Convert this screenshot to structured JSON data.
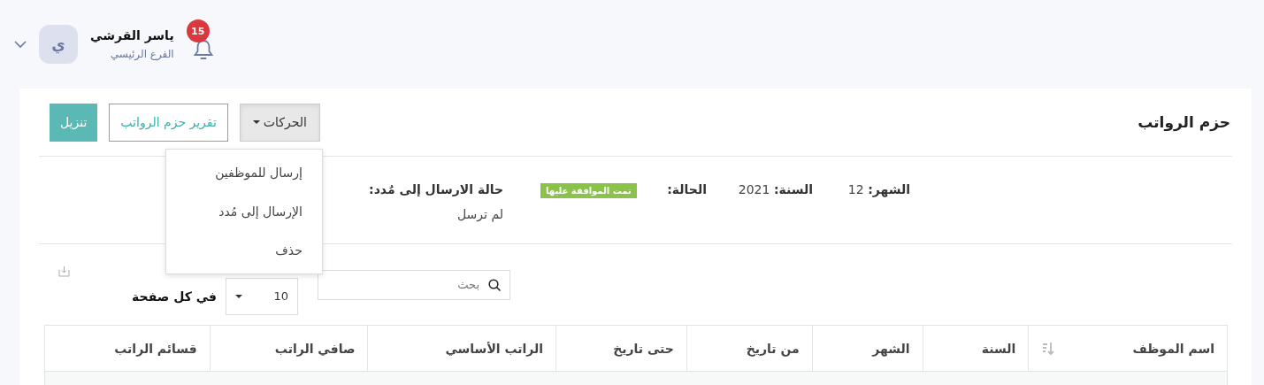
{
  "header": {
    "user": {
      "initial": "ي",
      "name": "ياسر القرشي",
      "branch": "الفرع الرئيسي"
    },
    "notifications": {
      "count": "15"
    }
  },
  "page": {
    "title": "حزم الرواتب",
    "buttons": [
      {
        "label": "تقرير حزم الرواتب",
        "kind": "outline"
      },
      {
        "label": "تنزيل",
        "kind": "primary"
      }
    ],
    "actions": {
      "label": "الحركات",
      "expanded": true,
      "items": [
        "إرسال للموظفين",
        "الإرسال إلى مُدد",
        "حذف"
      ]
    }
  },
  "details": [
    {
      "label": "الشهر:",
      "value": "12",
      "kind": "text"
    },
    {
      "label": "السنة:",
      "value": "2021",
      "kind": "text"
    },
    {
      "label": "الحالة:",
      "value": "تمت الموافقة عليها",
      "kind": "badge"
    },
    {
      "label": "حالة الارسال إلى مُدد:",
      "value": "لم ترسل",
      "kind": "text"
    }
  ],
  "table_controls": {
    "search": {
      "placeholder": "بحث"
    },
    "page_size": {
      "value": "10",
      "label": "في كل صفحة"
    }
  },
  "table": {
    "columns": [
      {
        "label": "اسم الموظف",
        "sortable": true
      },
      {
        "label": "السنة",
        "sortable": false
      },
      {
        "label": "الشهر",
        "sortable": false
      },
      {
        "label": "من تاريخ",
        "sortable": false
      },
      {
        "label": "حتى تاريخ",
        "sortable": false
      },
      {
        "label": "الراتب الأساسي",
        "sortable": false
      },
      {
        "label": "صافي الراتب",
        "sortable": false
      },
      {
        "label": "قسائم الراتب",
        "sortable": false
      }
    ]
  }
}
